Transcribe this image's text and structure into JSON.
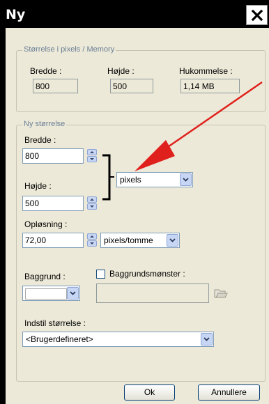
{
  "window": {
    "title": "Ny"
  },
  "groups": {
    "memory": {
      "legend": "Størrelse i pixels / Memory",
      "width_label": "Bredde :",
      "width_value": "800",
      "height_label": "Højde :",
      "height_value": "500",
      "memory_label": "Hukommelse :",
      "memory_value": "1,14 MB"
    },
    "new_size": {
      "legend": "Ny størrelse",
      "width_label": "Bredde :",
      "width_value": "800",
      "height_label": "Højde :",
      "height_value": "500",
      "unit_value": "pixels",
      "resolution_label": "Opløsning :",
      "resolution_value": "72,00",
      "resolution_unit": "pixels/tomme",
      "background_label": "Baggrund :",
      "pattern_label": "Baggrundsmønster :",
      "preset_label": "Indstil størrelse :",
      "preset_value": "<Brugerdefineret>"
    }
  },
  "buttons": {
    "ok": "Ok",
    "cancel": "Annullere"
  },
  "colors": {
    "arrow": "#e0201c",
    "dialog_bg": "#ece9d8",
    "titlebar": "#000000"
  }
}
